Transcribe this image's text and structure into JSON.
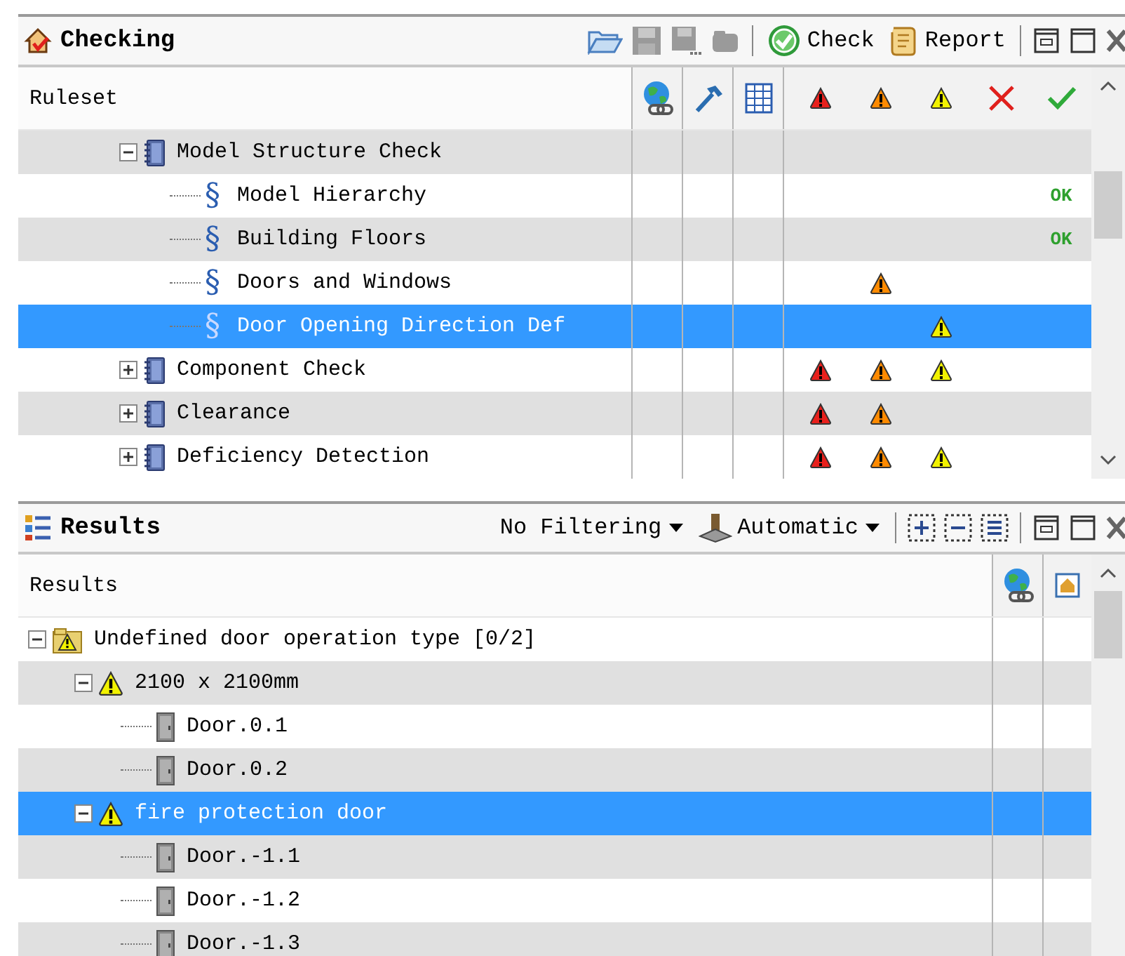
{
  "checking": {
    "title": "Checking",
    "check_button": "Check",
    "report_button": "Report"
  },
  "ruleset": {
    "column": "Ruleset",
    "rows": [
      {
        "label": "Model Structure Check",
        "kind": "folder",
        "expanded": true,
        "selected": false,
        "critical": false,
        "major": false,
        "minor": false,
        "children": [
          {
            "label": "Model Hierarchy",
            "kind": "rule",
            "marker": "§",
            "selected": false,
            "critical": false,
            "major": false,
            "minor": false,
            "result": "OK"
          },
          {
            "label": "Building Floors",
            "kind": "rule",
            "marker": "§",
            "selected": false,
            "critical": false,
            "major": false,
            "minor": false,
            "result": "OK"
          },
          {
            "label": "Doors and Windows",
            "kind": "rule",
            "marker": "§",
            "selected": false,
            "critical": false,
            "major": true,
            "minor": false
          },
          {
            "label": "Door Opening Direction Def",
            "kind": "rule",
            "marker": "§",
            "selected": true,
            "critical": false,
            "major": false,
            "minor": true
          }
        ]
      },
      {
        "label": "Component Check",
        "kind": "folder",
        "expanded": false,
        "selected": false,
        "critical": true,
        "major": true,
        "minor": true
      },
      {
        "label": "Clearance",
        "kind": "folder",
        "expanded": false,
        "selected": false,
        "critical": true,
        "major": true,
        "minor": false
      },
      {
        "label": "Deficiency Detection",
        "kind": "folder",
        "expanded": false,
        "selected": false,
        "critical": true,
        "major": true,
        "minor": true
      }
    ]
  },
  "results_panel": {
    "title": "Results",
    "filter": "No Filtering",
    "mode": "Automatic"
  },
  "results": {
    "column": "Results",
    "rows": [
      {
        "label": "Undefined door operation type [0/2]",
        "kind": "group",
        "expanded": true,
        "selected": false,
        "children": [
          {
            "label": "2100 x 2100mm",
            "kind": "warning",
            "expanded": true,
            "selected": false,
            "children": [
              {
                "label": "Door.0.1",
                "kind": "door",
                "selected": false
              },
              {
                "label": "Door.0.2",
                "kind": "door",
                "selected": false
              }
            ]
          },
          {
            "label": "fire protection door",
            "kind": "warning",
            "expanded": true,
            "selected": true,
            "children": [
              {
                "label": "Door.-1.1",
                "kind": "door",
                "selected": false
              },
              {
                "label": "Door.-1.2",
                "kind": "door",
                "selected": false
              },
              {
                "label": "Door.-1.3",
                "kind": "door",
                "selected": false
              }
            ]
          }
        ]
      }
    ]
  }
}
